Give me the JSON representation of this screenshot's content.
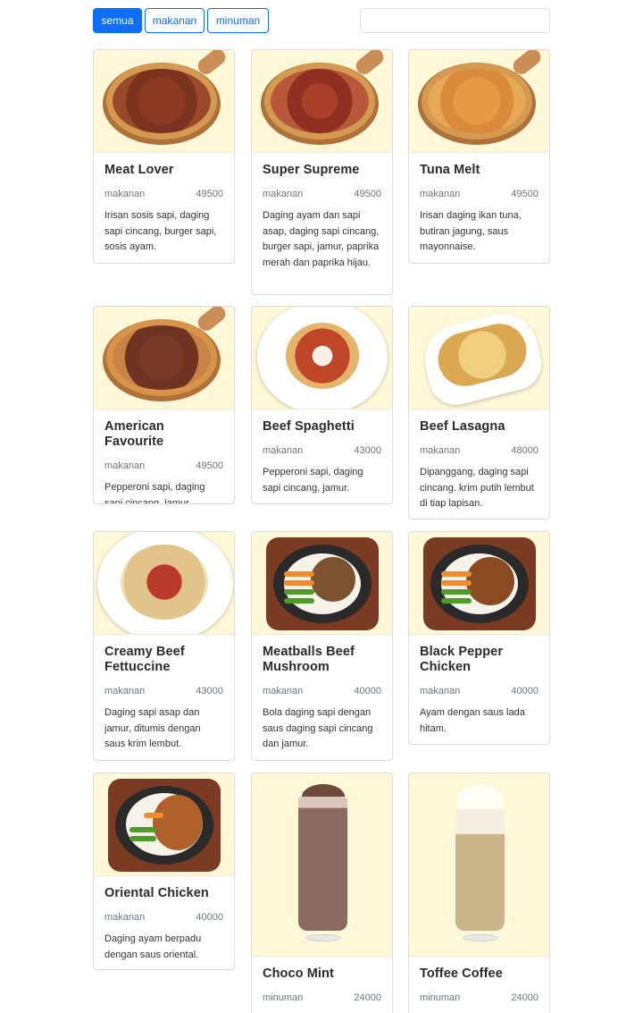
{
  "filters": {
    "all_label": "semua",
    "food_label": "makanan",
    "drink_label": "minuman",
    "active": "semua"
  },
  "search": {
    "placeholder": "",
    "value": ""
  },
  "colors": {
    "accent": "#0d6efd",
    "image_bg": "#fff8d8"
  },
  "products": [
    {
      "name": "Meat Lover",
      "category": "makanan",
      "price": "49500",
      "description": "Irisan sosis sapi, daging sapi cincang, burger sapi, sosis ayam.",
      "image": "pizza"
    },
    {
      "name": "Super Supreme",
      "category": "makanan",
      "price": "49500",
      "description": "Daging ayam dan sapi asap, daging sapi cincang, burger sapi, jamur, paprika merah dan paprika hijau.",
      "image": "pizza"
    },
    {
      "name": "Tuna Melt",
      "category": "makanan",
      "price": "49500",
      "description": "Irisan daging ikan tuna, butiran jagung, saus mayonnaise.",
      "image": "pizza"
    },
    {
      "name": "American Favourite",
      "category": "makanan",
      "price": "49500",
      "description": "Pepperoni sapi, daging sapi cincang, jamur.",
      "image": "pizza"
    },
    {
      "name": "Beef Spaghetti",
      "category": "makanan",
      "price": "43000",
      "description": "Pepperoni sapi, daging sapi cincang, jamur.",
      "image": "pasta"
    },
    {
      "name": "Beef Lasagna",
      "category": "makanan",
      "price": "48000",
      "description": "Dipanggang, daging sapi cincang. krim putih lembut di tiap lapisan.",
      "image": "lasagna"
    },
    {
      "name": "Creamy Beef Fettuccine",
      "category": "makanan",
      "price": "43000",
      "description": "Daging sapi asap dan jamur, ditumis dengan saus krim lembut.",
      "image": "pasta"
    },
    {
      "name": "Meatballs Beef Mushroom",
      "category": "makanan",
      "price": "40000",
      "description": "Bola daging sapi dengan saus daging sapi cincang dan jamur.",
      "image": "sizzling"
    },
    {
      "name": "Black Pepper Chicken",
      "category": "makanan",
      "price": "40000",
      "description": "Ayam dengan saus lada hitam.",
      "image": "sizzling"
    },
    {
      "name": "Oriental Chicken",
      "category": "makanan",
      "price": "40000",
      "description": "Daging ayam berpadu dengan saus oriental.",
      "image": "sizzling"
    },
    {
      "name": "Choco Mint",
      "category": "minuman",
      "price": "24000",
      "description": "",
      "image": "drink"
    },
    {
      "name": "Toffee Coffee",
      "category": "minuman",
      "price": "24000",
      "description": "",
      "image": "drink"
    }
  ]
}
